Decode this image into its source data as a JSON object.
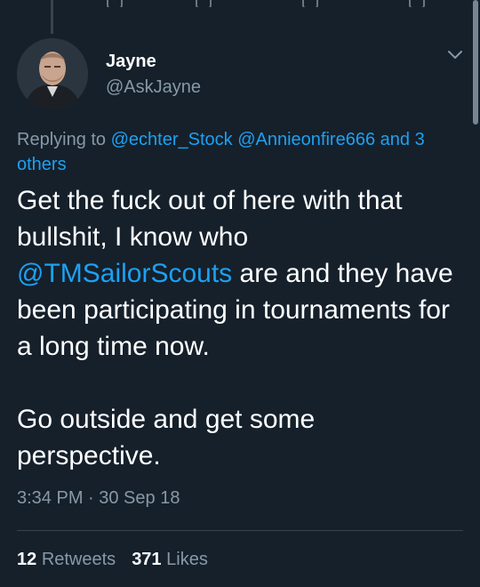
{
  "tweet": {
    "author": {
      "name": "Jayne",
      "handle": "@AskJayne"
    },
    "reply": {
      "prefix": "Replying to",
      "mention_1": "@echter_Stock",
      "mention_2": "@Annieonfire666",
      "and": "and",
      "others": "3 others"
    },
    "body": {
      "line_1": "Get the fuck out of here with that bullshit, I know who",
      "mention": "@TMSailorScouts",
      "line_2": "are and they have been participating in tournaments for a long time now.",
      "paragraph_2": "Go outside and get some perspective."
    },
    "timestamp": "3:34 PM · 30 Sep 18",
    "stats": {
      "retweets_count": "12",
      "retweets_label": "Retweets",
      "likes_count": "371",
      "likes_label": "Likes"
    }
  },
  "colors": {
    "background": "#15202b",
    "text": "#ffffff",
    "secondary_text": "#8899a6",
    "link": "#1da1f2",
    "divider": "#38444d"
  },
  "icons": [
    "chevron-down-icon",
    "avatar"
  ]
}
